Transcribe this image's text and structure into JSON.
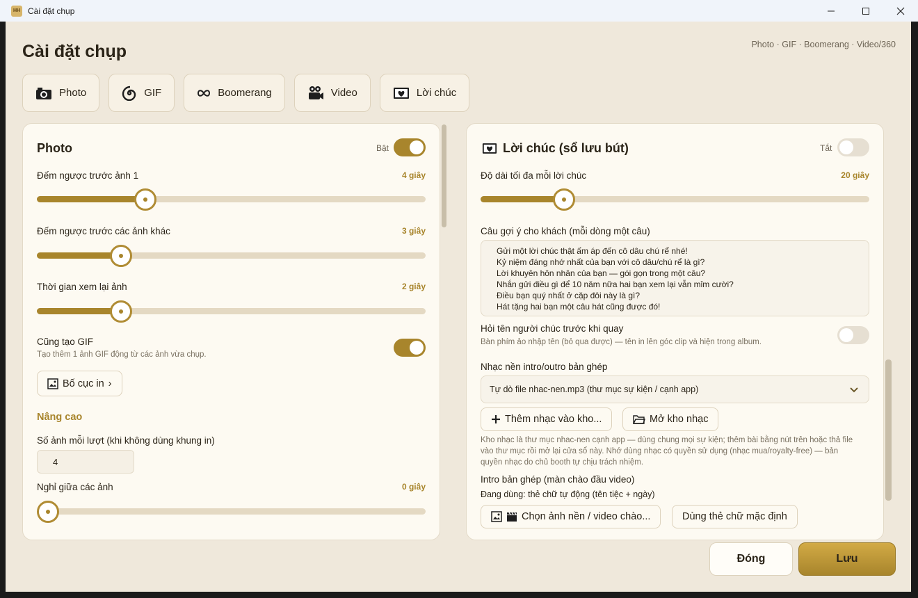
{
  "window": {
    "title": "Cài đặt chụp",
    "app_icon": "HH"
  },
  "header": {
    "title": "Cài đặt chụp",
    "subtitle": "Photo · GIF · Boomerang · Video/360"
  },
  "tabs": [
    {
      "label": "Photo",
      "icon": "camera-icon"
    },
    {
      "label": "GIF",
      "icon": "spiral-icon"
    },
    {
      "label": "Boomerang",
      "icon": "infinity-icon"
    },
    {
      "label": "Video",
      "icon": "video-camera-icon"
    },
    {
      "label": "Lời chúc",
      "icon": "envelope-heart-icon"
    }
  ],
  "photo": {
    "title": "Photo",
    "toggle_label": "Bật",
    "enabled": true,
    "countdown_first": {
      "label": "Đếm ngược trước ảnh 1",
      "value": "4 giây",
      "fraction": 0.27
    },
    "countdown_other": {
      "label": "Đếm ngược trước các ảnh khác",
      "value": "3 giây",
      "fraction": 0.21
    },
    "review_time": {
      "label": "Thời gian xem lại ảnh",
      "value": "2 giây",
      "fraction": 0.21
    },
    "also_gif": {
      "label": "Cũng tạo GIF",
      "hint": "Tạo thêm 1 ảnh GIF động từ các ảnh vừa chụp.",
      "enabled": true
    },
    "layout_button": "Bố cục in",
    "layout_chevron": "›",
    "advanced_heading": "Nâng cao",
    "shots_per_round": {
      "label": "Số ảnh mỗi lượt (khi không dùng khung in)",
      "value": "4"
    },
    "pause_between": {
      "label": "Nghỉ giữa các ảnh",
      "value": "0 giây",
      "fraction": 0.0
    }
  },
  "guestbook": {
    "title": "Lời chúc (sổ lưu bút)",
    "toggle_label": "Tắt",
    "enabled": false,
    "max_length": {
      "label": "Độ dài tối đa mỗi lời chúc",
      "value": "20 giây",
      "fraction": 0.22
    },
    "prompts_label": "Câu gợi ý cho khách (mỗi dòng một câu)",
    "prompts": [
      "Gửi một lời chúc thật ấm áp đến cô dâu chú rể nhé!",
      "Kỷ niệm đáng nhớ nhất của bạn với cô dâu/chú rể là gì?",
      "Lời khuyên hôn nhân của bạn — gói gọn trong một câu?",
      "Nhắn gửi điều gì để 10 năm nữa hai bạn xem lại vẫn mỉm cười?",
      "Điều bạn quý nhất ở cặp đôi này là gì?",
      "Hát tặng hai bạn một câu hát cũng được đó!"
    ],
    "ask_name": {
      "label": "Hỏi tên người chúc trước khi quay",
      "hint": "Bàn phím ảo nhập tên (bỏ qua được) — tên in lên góc clip và hiện trong album.",
      "enabled": false
    },
    "music_label": "Nhạc nền intro/outro bản ghép",
    "music_select": "Tự dò file nhac-nen.mp3 (thư mục sự kiện / cạnh app)",
    "add_music_button": "Thêm nhạc vào kho...",
    "open_library_button": "Mở kho nhạc",
    "music_note": [
      "Kho nhạc là thư mục nhac-nen cạnh app — dùng chung mọi sự kiện; thêm bài bằng nút trên hoặc thả file",
      "vào thư mục rồi mở lại cửa sổ này. Nhớ dùng nhạc có quyền sử dụng (nhạc mua/royalty-free) — bản",
      "quyền nhạc do chủ booth tự chịu trách nhiệm."
    ],
    "intro_label": "Intro bản ghép (màn chào đầu video)",
    "intro_current": "Đang dùng: thẻ chữ tự động (tên tiệc + ngày)",
    "choose_bg_button": "Chọn ảnh nền / video chào...",
    "default_card_button": "Dùng thẻ chữ mặc định"
  },
  "footer": {
    "close_label": "Đóng",
    "save_label": "Lưu"
  },
  "colors": {
    "accent": "#a8852c",
    "background": "#efe8db",
    "panel": "#fdfaf2"
  }
}
